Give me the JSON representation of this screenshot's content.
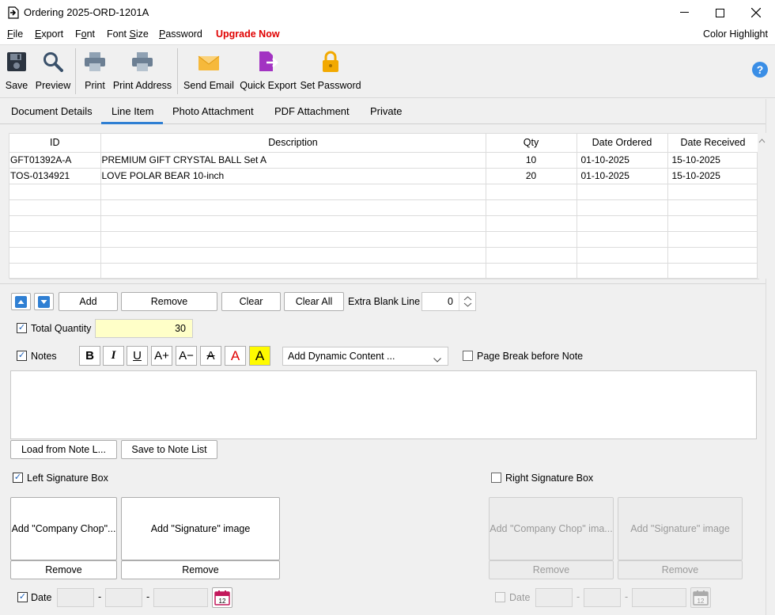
{
  "window": {
    "title": "Ordering 2025-ORD-1201A"
  },
  "menu": {
    "items": [
      {
        "label": "File"
      },
      {
        "label": "Export"
      },
      {
        "label": "Font"
      },
      {
        "label": "Font Size"
      },
      {
        "label": "Password"
      },
      {
        "label": "Upgrade Now"
      }
    ],
    "right_label": "Color Highlight",
    "upgrade_color": "#e00000"
  },
  "toolbar": {
    "save": "Save",
    "preview": "Preview",
    "print": "Print",
    "print_address": "Print Address",
    "send_email": "Send Email",
    "quick_export": "Quick Export",
    "set_password": "Set Password"
  },
  "tabs": [
    {
      "label": "Document Details"
    },
    {
      "label": "Line Item"
    },
    {
      "label": "Photo Attachment"
    },
    {
      "label": "PDF Attachment"
    },
    {
      "label": "Private"
    }
  ],
  "active_tab": "Line Item",
  "grid": {
    "columns": [
      "ID",
      "Description",
      "Qty",
      "Date Ordered",
      "Date Received"
    ],
    "rows": [
      [
        "GFT01392A-A",
        "PREMIUM GIFT CRYSTAL BALL Set A",
        "10",
        "01-10-2025",
        "15-10-2025"
      ],
      [
        "TOS-0134921",
        "LOVE POLAR BEAR 10-inch",
        "20",
        "01-10-2025",
        "15-10-2025"
      ]
    ]
  },
  "line_actions": {
    "add": "Add",
    "remove": "Remove",
    "clear": "Clear",
    "clear_all": "Clear All",
    "extra_blank_label": "Extra Blank Line",
    "extra_blank_value": "0"
  },
  "total_quantity": {
    "label": "Total Quantity",
    "checked": true,
    "value": "30"
  },
  "notes": {
    "label": "Notes",
    "checked": true,
    "dynamic_content": "Add Dynamic Content ...",
    "page_break_label": "Page Break before Note",
    "load_button": "Load from Note L...",
    "save_button": "Save to Note List",
    "text": ""
  },
  "left_signature": {
    "label": "Left Signature Box",
    "checked": true,
    "company_chop": "Add \"Company Chop\"...",
    "signature": "Add \"Signature\" image",
    "remove": "Remove",
    "date_label": "Date",
    "date_checked": true
  },
  "right_signature": {
    "label": "Right Signature Box",
    "checked": false,
    "company_chop": "Add \"Company Chop\" ima...",
    "signature": "Add \"Signature\" image",
    "remove": "Remove",
    "date_label": "Date",
    "date_checked": false
  },
  "date_separator": "-",
  "calendar_day": "12",
  "colors": {
    "accent": "#2f7fd3",
    "help": "#3a8ee6",
    "email": "#f6b93b",
    "export": "#a233c2",
    "lock": "#f2a900",
    "highlight_yellow": "#fffb00",
    "total_bg": "#ffffc8"
  }
}
